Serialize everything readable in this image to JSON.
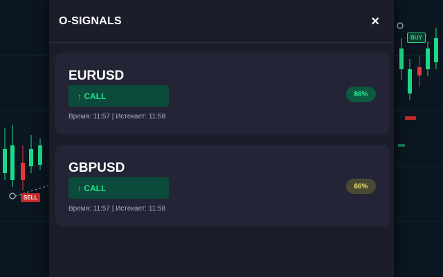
{
  "background": {
    "buy_tag": "BUY",
    "sell_tag": "SELL"
  },
  "panel": {
    "title": "O-SIGNALS",
    "close_label": "×"
  },
  "signals": [
    {
      "pair": "EURUSD",
      "direction": "↑ CALL",
      "time_text": "Время: 11:57 | Истекает: 11:58",
      "confidence": "86%",
      "confidence_color": "#2ef09a"
    },
    {
      "pair": "GBPUSD",
      "direction": "↑ CALL",
      "time_text": "Время: 11:57 | Истекает: 11:58",
      "confidence": "66%",
      "confidence_color": "#f3e06a"
    }
  ],
  "colors": {
    "call_green": "#1fe08a",
    "panel_bg": "#1b1d2b",
    "card_bg": "#232536"
  }
}
